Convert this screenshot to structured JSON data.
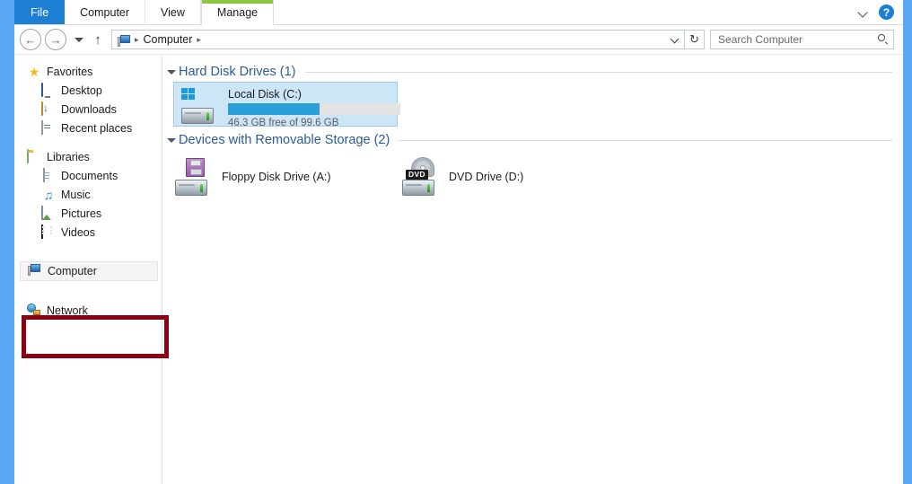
{
  "window": {
    "border_color": "#5aa7f7"
  },
  "ribbon": {
    "tabs": [
      {
        "label": "File",
        "kind": "file"
      },
      {
        "label": "Computer",
        "kind": "normal"
      },
      {
        "label": "View",
        "kind": "normal"
      },
      {
        "label": "Manage",
        "kind": "contextual-active",
        "accent": "#8cc63f"
      }
    ],
    "expand_icon": "chevron-down-icon",
    "help_label": "?"
  },
  "navigation": {
    "back_label": "←",
    "forward_label": "→",
    "recent_label": "recent-locations-dropdown",
    "up_label": "↑",
    "refresh_label": "↻",
    "breadcrumb": {
      "icon": "computer-icon",
      "sep1": "▸",
      "path": "Computer",
      "sep2": "▸"
    }
  },
  "search": {
    "placeholder": "Search Computer",
    "value": "",
    "icon": "search-icon"
  },
  "sidebar": {
    "groups": [
      {
        "root": {
          "label": "Favorites",
          "icon": "star-icon"
        },
        "items": [
          {
            "label": "Desktop",
            "icon": "desktop-icon"
          },
          {
            "label": "Downloads",
            "icon": "downloads-icon"
          },
          {
            "label": "Recent places",
            "icon": "recent-places-icon"
          }
        ]
      },
      {
        "root": {
          "label": "Libraries",
          "icon": "libraries-icon"
        },
        "items": [
          {
            "label": "Documents",
            "icon": "documents-icon"
          },
          {
            "label": "Music",
            "icon": "music-icon"
          },
          {
            "label": "Pictures",
            "icon": "pictures-icon"
          },
          {
            "label": "Videos",
            "icon": "videos-icon"
          }
        ]
      }
    ],
    "computer": {
      "label": "Computer",
      "icon": "computer-icon",
      "highlighted": true
    },
    "network": {
      "label": "Network",
      "icon": "network-icon"
    },
    "highlight_color": "#8b0012"
  },
  "content": {
    "groups": [
      {
        "title": "Hard Disk Drives (1)",
        "expanded": true,
        "drives": [
          {
            "name": "Local Disk (C:)",
            "capacity_text": "46.3 GB free of 99.6 GB",
            "free_gb": 46.3,
            "total_gb": 99.6,
            "used_percent": 53,
            "selected": true,
            "icon": "hard-disk-icon",
            "bar_color": "#2c9fd9",
            "bar_track_color": "#e3e3e3"
          }
        ]
      },
      {
        "title": "Devices with Removable Storage (2)",
        "expanded": true,
        "devices": [
          {
            "name": "Floppy Disk Drive (A:)",
            "icon": "floppy-drive-icon"
          },
          {
            "name": "DVD Drive (D:)",
            "icon": "dvd-drive-icon",
            "badge": "DVD"
          }
        ]
      }
    ]
  }
}
